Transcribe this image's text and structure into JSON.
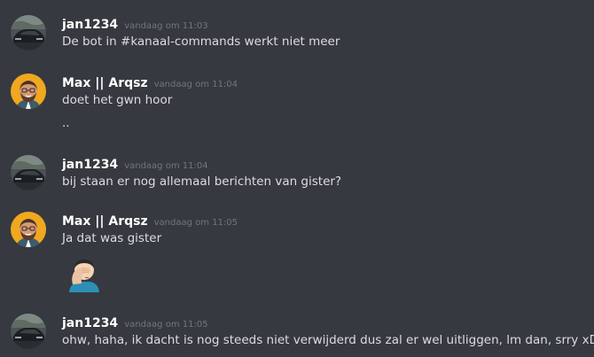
{
  "messages": [
    {
      "author": "jan1234",
      "timestamp": "vandaag om 11:03",
      "lines": [
        "De bot in #kanaal-commands werkt niet meer"
      ]
    },
    {
      "author": "Max || Arqsz",
      "timestamp": "vandaag om 11:04",
      "lines": [
        "doet het gwn hoor",
        ".."
      ]
    },
    {
      "author": "jan1234",
      "timestamp": "vandaag om 11:04",
      "lines": [
        "bij staan er nog allemaal berichten van gister?"
      ]
    },
    {
      "author": "Max || Arqsz",
      "timestamp": "vandaag om 11:05",
      "lines": [
        "Ja dat was gister"
      ],
      "emoji": "person-facepalming"
    },
    {
      "author": "jan1234",
      "timestamp": "vandaag om 11:05",
      "lines": [
        "ohw, haha, ik dacht is nog steeds niet verwijderd dus zal er wel uitliggen, lm dan, srry xD"
      ]
    }
  ],
  "colors": {
    "background": "#36393f",
    "username": "#ffffff",
    "text": "#dcddde",
    "timestamp": "#72767d"
  }
}
